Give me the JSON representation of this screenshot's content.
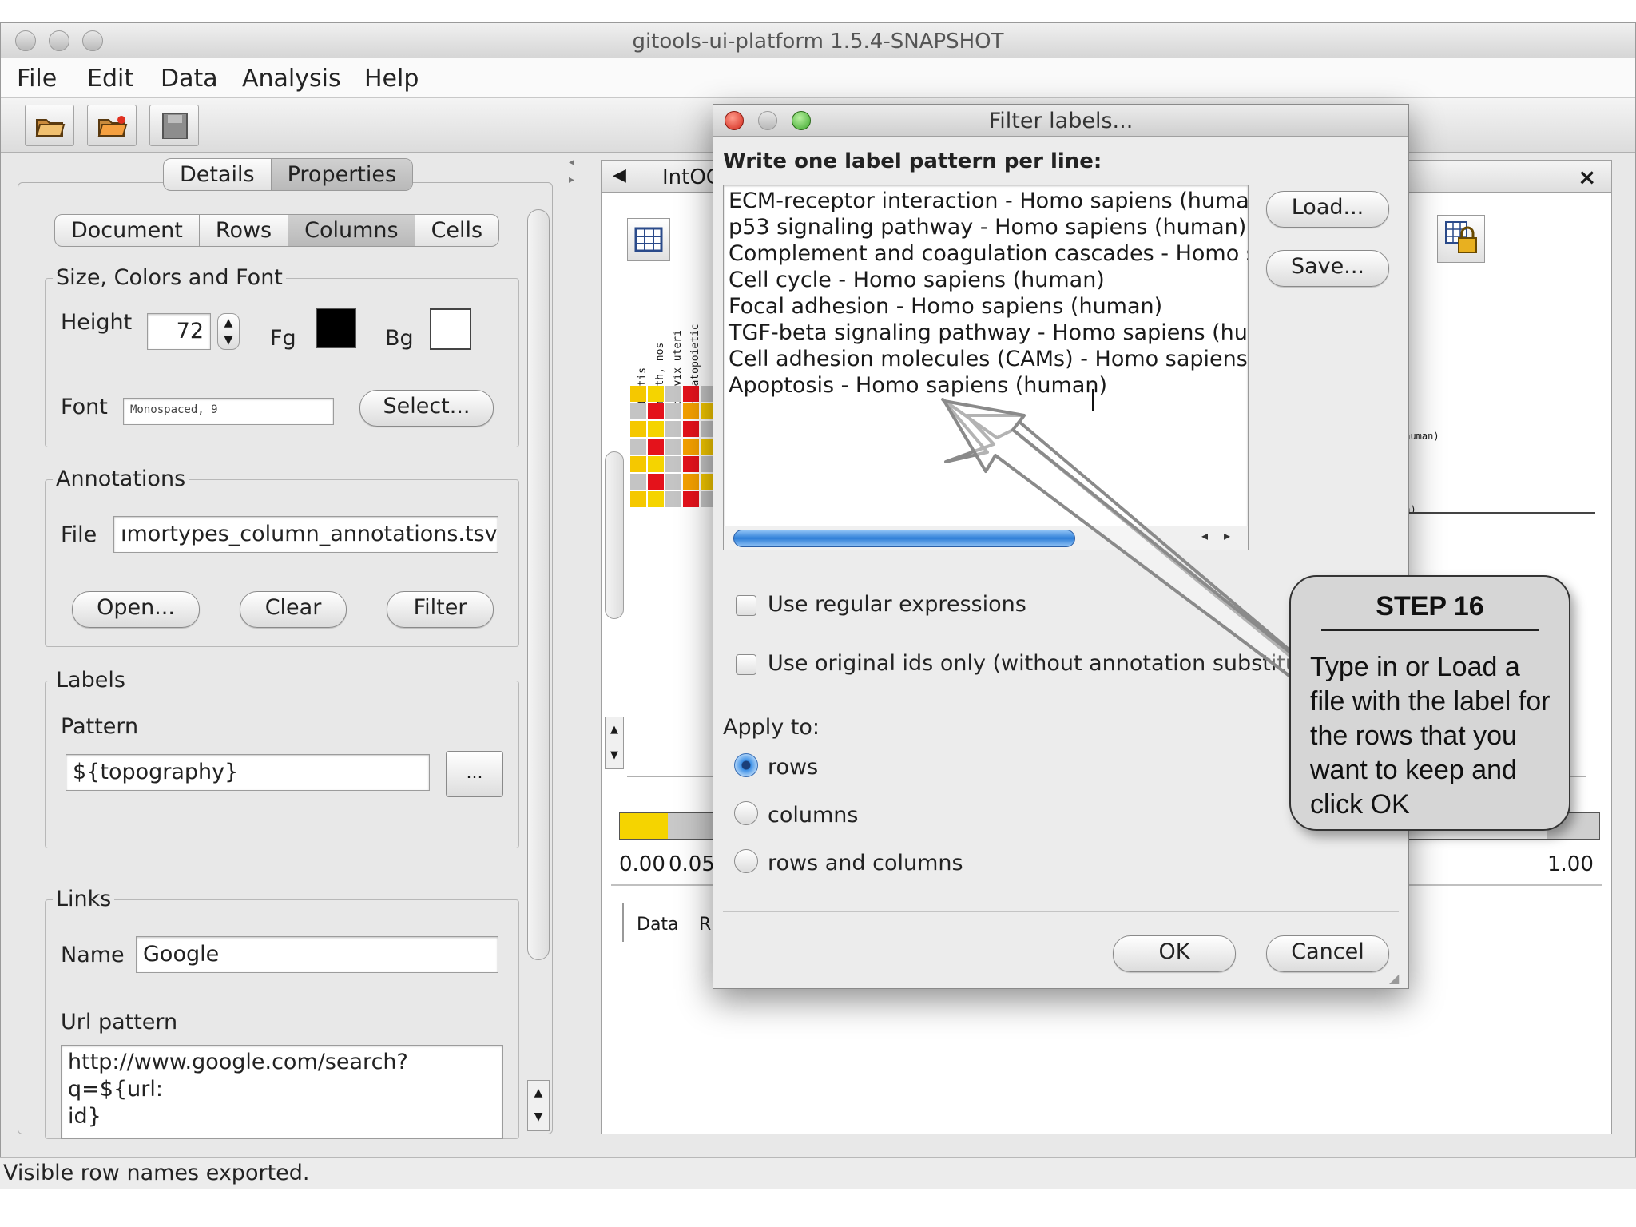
{
  "window": {
    "title": "gitools-ui-platform 1.5.4-SNAPSHOT"
  },
  "menu": [
    "File",
    "Edit",
    "Data",
    "Analysis",
    "Help"
  ],
  "toolbar": {
    "icons": [
      "open-folder-icon",
      "open-folder-icon",
      "save-icon"
    ]
  },
  "left_panel": {
    "top_tabs": [
      "Details",
      "Properties"
    ],
    "selected_top_tab": "Properties",
    "sub_tabs": [
      "Document",
      "Rows",
      "Columns",
      "Cells"
    ],
    "selected_sub_tab": "Columns",
    "size_group": {
      "title": "Size, Colors and Font",
      "height_label": "Height",
      "height_value": "72",
      "fg_label": "Fg",
      "bg_label": "Bg",
      "fg_color": "#000000",
      "bg_color": "#ffffff",
      "font_label": "Font",
      "font_value": "Monospaced, 9",
      "select_button": "Select..."
    },
    "annotations_group": {
      "title": "Annotations",
      "file_label": "File",
      "file_value": "ımortypes_column_annotations.tsv",
      "open_button": "Open...",
      "clear_button": "Clear",
      "filter_button": "Filter"
    },
    "labels_group": {
      "title": "Labels",
      "pattern_label": "Pattern",
      "pattern_value": "${topography}",
      "browse_button": "..."
    },
    "links_group": {
      "title": "Links",
      "name_label": "Name",
      "name_value": "Google",
      "url_label": "Url pattern",
      "url_value_line1": "http://www.google.com/search?q=${url:",
      "url_value_line2": "id}"
    }
  },
  "right_panel": {
    "tab_label": "IntOG",
    "column_headers": [
      "testis",
      "mouth, nos",
      "cervix uteri",
      "hematopoietic"
    ],
    "bg_text_1": "(human)",
    "bg_text_2": "an)",
    "scale_min": "0.00",
    "scale_mid": "0.05",
    "scale_max": "1.00",
    "bottom_tabs": [
      "Data",
      "R"
    ]
  },
  "dialog": {
    "title": "Filter labels...",
    "instruction": "Write one label pattern per line:",
    "patterns": [
      "ECM-receptor interaction - Homo sapiens (huma",
      "p53 signaling pathway - Homo sapiens (human)",
      "Complement and coagulation cascades - Homo s",
      "Cell cycle - Homo sapiens (human)",
      "Focal adhesion - Homo sapiens (human)",
      "TGF-beta signaling pathway - Homo sapiens (hur",
      "Cell adhesion molecules (CAMs) - Homo sapiens",
      "Apoptosis - Homo sapiens (human)"
    ],
    "load_button": "Load...",
    "save_button": "Save...",
    "use_regex": "Use regular expressions",
    "use_original_ids": "Use original ids only (without annotation substitu",
    "apply_to_label": "Apply to:",
    "apply_options": [
      "rows",
      "columns",
      "rows and columns"
    ],
    "apply_selected": "rows",
    "ok_button": "OK",
    "cancel_button": "Cancel"
  },
  "callout": {
    "title": "STEP 16",
    "text_lines": [
      "Type in or Load a",
      "file with the label for",
      "the rows that you",
      "want to keep and",
      "click OK"
    ]
  },
  "status": "Visible row names exported."
}
